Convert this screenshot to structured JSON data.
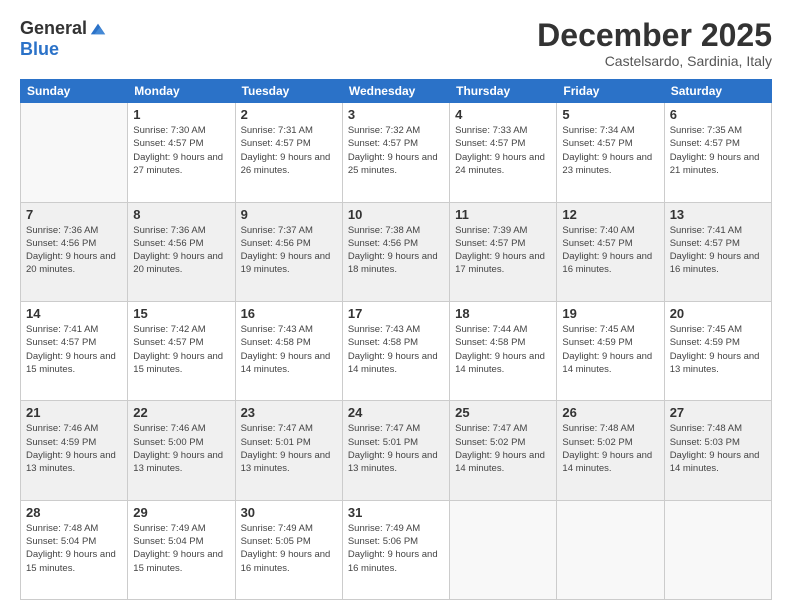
{
  "header": {
    "logo_general": "General",
    "logo_blue": "Blue",
    "month_title": "December 2025",
    "subtitle": "Castelsardo, Sardinia, Italy"
  },
  "weekdays": [
    "Sunday",
    "Monday",
    "Tuesday",
    "Wednesday",
    "Thursday",
    "Friday",
    "Saturday"
  ],
  "weeks": [
    [
      {
        "day": "",
        "sunrise": "",
        "sunset": "",
        "daylight": ""
      },
      {
        "day": "1",
        "sunrise": "Sunrise: 7:30 AM",
        "sunset": "Sunset: 4:57 PM",
        "daylight": "Daylight: 9 hours and 27 minutes."
      },
      {
        "day": "2",
        "sunrise": "Sunrise: 7:31 AM",
        "sunset": "Sunset: 4:57 PM",
        "daylight": "Daylight: 9 hours and 26 minutes."
      },
      {
        "day": "3",
        "sunrise": "Sunrise: 7:32 AM",
        "sunset": "Sunset: 4:57 PM",
        "daylight": "Daylight: 9 hours and 25 minutes."
      },
      {
        "day": "4",
        "sunrise": "Sunrise: 7:33 AM",
        "sunset": "Sunset: 4:57 PM",
        "daylight": "Daylight: 9 hours and 24 minutes."
      },
      {
        "day": "5",
        "sunrise": "Sunrise: 7:34 AM",
        "sunset": "Sunset: 4:57 PM",
        "daylight": "Daylight: 9 hours and 23 minutes."
      },
      {
        "day": "6",
        "sunrise": "Sunrise: 7:35 AM",
        "sunset": "Sunset: 4:57 PM",
        "daylight": "Daylight: 9 hours and 21 minutes."
      }
    ],
    [
      {
        "day": "7",
        "sunrise": "Sunrise: 7:36 AM",
        "sunset": "Sunset: 4:56 PM",
        "daylight": "Daylight: 9 hours and 20 minutes."
      },
      {
        "day": "8",
        "sunrise": "Sunrise: 7:36 AM",
        "sunset": "Sunset: 4:56 PM",
        "daylight": "Daylight: 9 hours and 20 minutes."
      },
      {
        "day": "9",
        "sunrise": "Sunrise: 7:37 AM",
        "sunset": "Sunset: 4:56 PM",
        "daylight": "Daylight: 9 hours and 19 minutes."
      },
      {
        "day": "10",
        "sunrise": "Sunrise: 7:38 AM",
        "sunset": "Sunset: 4:56 PM",
        "daylight": "Daylight: 9 hours and 18 minutes."
      },
      {
        "day": "11",
        "sunrise": "Sunrise: 7:39 AM",
        "sunset": "Sunset: 4:57 PM",
        "daylight": "Daylight: 9 hours and 17 minutes."
      },
      {
        "day": "12",
        "sunrise": "Sunrise: 7:40 AM",
        "sunset": "Sunset: 4:57 PM",
        "daylight": "Daylight: 9 hours and 16 minutes."
      },
      {
        "day": "13",
        "sunrise": "Sunrise: 7:41 AM",
        "sunset": "Sunset: 4:57 PM",
        "daylight": "Daylight: 9 hours and 16 minutes."
      }
    ],
    [
      {
        "day": "14",
        "sunrise": "Sunrise: 7:41 AM",
        "sunset": "Sunset: 4:57 PM",
        "daylight": "Daylight: 9 hours and 15 minutes."
      },
      {
        "day": "15",
        "sunrise": "Sunrise: 7:42 AM",
        "sunset": "Sunset: 4:57 PM",
        "daylight": "Daylight: 9 hours and 15 minutes."
      },
      {
        "day": "16",
        "sunrise": "Sunrise: 7:43 AM",
        "sunset": "Sunset: 4:58 PM",
        "daylight": "Daylight: 9 hours and 14 minutes."
      },
      {
        "day": "17",
        "sunrise": "Sunrise: 7:43 AM",
        "sunset": "Sunset: 4:58 PM",
        "daylight": "Daylight: 9 hours and 14 minutes."
      },
      {
        "day": "18",
        "sunrise": "Sunrise: 7:44 AM",
        "sunset": "Sunset: 4:58 PM",
        "daylight": "Daylight: 9 hours and 14 minutes."
      },
      {
        "day": "19",
        "sunrise": "Sunrise: 7:45 AM",
        "sunset": "Sunset: 4:59 PM",
        "daylight": "Daylight: 9 hours and 14 minutes."
      },
      {
        "day": "20",
        "sunrise": "Sunrise: 7:45 AM",
        "sunset": "Sunset: 4:59 PM",
        "daylight": "Daylight: 9 hours and 13 minutes."
      }
    ],
    [
      {
        "day": "21",
        "sunrise": "Sunrise: 7:46 AM",
        "sunset": "Sunset: 4:59 PM",
        "daylight": "Daylight: 9 hours and 13 minutes."
      },
      {
        "day": "22",
        "sunrise": "Sunrise: 7:46 AM",
        "sunset": "Sunset: 5:00 PM",
        "daylight": "Daylight: 9 hours and 13 minutes."
      },
      {
        "day": "23",
        "sunrise": "Sunrise: 7:47 AM",
        "sunset": "Sunset: 5:01 PM",
        "daylight": "Daylight: 9 hours and 13 minutes."
      },
      {
        "day": "24",
        "sunrise": "Sunrise: 7:47 AM",
        "sunset": "Sunset: 5:01 PM",
        "daylight": "Daylight: 9 hours and 13 minutes."
      },
      {
        "day": "25",
        "sunrise": "Sunrise: 7:47 AM",
        "sunset": "Sunset: 5:02 PM",
        "daylight": "Daylight: 9 hours and 14 minutes."
      },
      {
        "day": "26",
        "sunrise": "Sunrise: 7:48 AM",
        "sunset": "Sunset: 5:02 PM",
        "daylight": "Daylight: 9 hours and 14 minutes."
      },
      {
        "day": "27",
        "sunrise": "Sunrise: 7:48 AM",
        "sunset": "Sunset: 5:03 PM",
        "daylight": "Daylight: 9 hours and 14 minutes."
      }
    ],
    [
      {
        "day": "28",
        "sunrise": "Sunrise: 7:48 AM",
        "sunset": "Sunset: 5:04 PM",
        "daylight": "Daylight: 9 hours and 15 minutes."
      },
      {
        "day": "29",
        "sunrise": "Sunrise: 7:49 AM",
        "sunset": "Sunset: 5:04 PM",
        "daylight": "Daylight: 9 hours and 15 minutes."
      },
      {
        "day": "30",
        "sunrise": "Sunrise: 7:49 AM",
        "sunset": "Sunset: 5:05 PM",
        "daylight": "Daylight: 9 hours and 16 minutes."
      },
      {
        "day": "31",
        "sunrise": "Sunrise: 7:49 AM",
        "sunset": "Sunset: 5:06 PM",
        "daylight": "Daylight: 9 hours and 16 minutes."
      },
      {
        "day": "",
        "sunrise": "",
        "sunset": "",
        "daylight": ""
      },
      {
        "day": "",
        "sunrise": "",
        "sunset": "",
        "daylight": ""
      },
      {
        "day": "",
        "sunrise": "",
        "sunset": "",
        "daylight": ""
      }
    ]
  ]
}
